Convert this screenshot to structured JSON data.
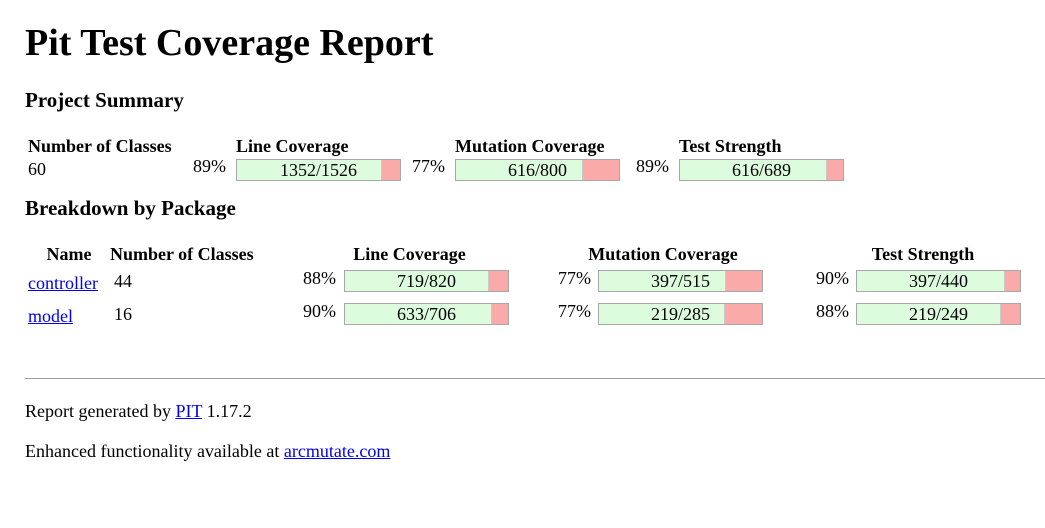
{
  "report": {
    "title": "Pit Test Coverage Report",
    "project_summary_heading": "Project Summary",
    "breakdown_heading": "Breakdown by Package"
  },
  "summary": {
    "headers": {
      "classes": "Number of Classes",
      "line": "Line Coverage",
      "mutation": "Mutation Coverage",
      "strength": "Test Strength"
    },
    "classes": "60",
    "line": {
      "pct": "89%",
      "legend": "1352/1526",
      "fraction": 0.886
    },
    "mutation": {
      "pct": "77%",
      "legend": "616/800",
      "fraction": 0.77
    },
    "strength": {
      "pct": "89%",
      "legend": "616/689",
      "fraction": 0.894
    }
  },
  "breakdown": {
    "headers": {
      "name": "Name",
      "classes": "Number of Classes",
      "line": "Line Coverage",
      "mutation": "Mutation Coverage",
      "strength": "Test Strength"
    },
    "rows": [
      {
        "name": "controller",
        "classes": "44",
        "line": {
          "pct": "88%",
          "legend": "719/820",
          "fraction": 0.877
        },
        "mutation": {
          "pct": "77%",
          "legend": "397/515",
          "fraction": 0.771
        },
        "strength": {
          "pct": "90%",
          "legend": "397/440",
          "fraction": 0.902
        }
      },
      {
        "name": "model",
        "classes": "16",
        "line": {
          "pct": "90%",
          "legend": "633/706",
          "fraction": 0.897
        },
        "mutation": {
          "pct": "77%",
          "legend": "219/285",
          "fraction": 0.768
        },
        "strength": {
          "pct": "88%",
          "legend": "219/249",
          "fraction": 0.88
        }
      }
    ]
  },
  "footer": {
    "generated_prefix": "Report generated by",
    "pit_link": "PIT",
    "version": "1.17.2",
    "enhanced_prefix": "Enhanced functionality available at",
    "arcmutate_link": "arcmutate.com"
  },
  "colors": {
    "covered": "#ddfcdd",
    "uncovered": "#fbaaaa",
    "link": "#0000ee"
  }
}
